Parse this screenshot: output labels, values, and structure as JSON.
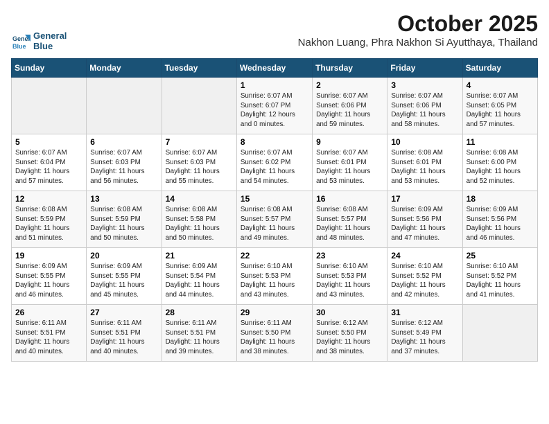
{
  "header": {
    "logo_line1": "General",
    "logo_line2": "Blue",
    "title": "October 2025",
    "subtitle": "Nakhon Luang, Phra Nakhon Si Ayutthaya, Thailand"
  },
  "weekdays": [
    "Sunday",
    "Monday",
    "Tuesday",
    "Wednesday",
    "Thursday",
    "Friday",
    "Saturday"
  ],
  "weeks": [
    [
      {
        "day": "",
        "info": ""
      },
      {
        "day": "",
        "info": ""
      },
      {
        "day": "",
        "info": ""
      },
      {
        "day": "1",
        "info": "Sunrise: 6:07 AM\nSunset: 6:07 PM\nDaylight: 12 hours\nand 0 minutes."
      },
      {
        "day": "2",
        "info": "Sunrise: 6:07 AM\nSunset: 6:06 PM\nDaylight: 11 hours\nand 59 minutes."
      },
      {
        "day": "3",
        "info": "Sunrise: 6:07 AM\nSunset: 6:06 PM\nDaylight: 11 hours\nand 58 minutes."
      },
      {
        "day": "4",
        "info": "Sunrise: 6:07 AM\nSunset: 6:05 PM\nDaylight: 11 hours\nand 57 minutes."
      }
    ],
    [
      {
        "day": "5",
        "info": "Sunrise: 6:07 AM\nSunset: 6:04 PM\nDaylight: 11 hours\nand 57 minutes."
      },
      {
        "day": "6",
        "info": "Sunrise: 6:07 AM\nSunset: 6:03 PM\nDaylight: 11 hours\nand 56 minutes."
      },
      {
        "day": "7",
        "info": "Sunrise: 6:07 AM\nSunset: 6:03 PM\nDaylight: 11 hours\nand 55 minutes."
      },
      {
        "day": "8",
        "info": "Sunrise: 6:07 AM\nSunset: 6:02 PM\nDaylight: 11 hours\nand 54 minutes."
      },
      {
        "day": "9",
        "info": "Sunrise: 6:07 AM\nSunset: 6:01 PM\nDaylight: 11 hours\nand 53 minutes."
      },
      {
        "day": "10",
        "info": "Sunrise: 6:08 AM\nSunset: 6:01 PM\nDaylight: 11 hours\nand 53 minutes."
      },
      {
        "day": "11",
        "info": "Sunrise: 6:08 AM\nSunset: 6:00 PM\nDaylight: 11 hours\nand 52 minutes."
      }
    ],
    [
      {
        "day": "12",
        "info": "Sunrise: 6:08 AM\nSunset: 5:59 PM\nDaylight: 11 hours\nand 51 minutes."
      },
      {
        "day": "13",
        "info": "Sunrise: 6:08 AM\nSunset: 5:59 PM\nDaylight: 11 hours\nand 50 minutes."
      },
      {
        "day": "14",
        "info": "Sunrise: 6:08 AM\nSunset: 5:58 PM\nDaylight: 11 hours\nand 50 minutes."
      },
      {
        "day": "15",
        "info": "Sunrise: 6:08 AM\nSunset: 5:57 PM\nDaylight: 11 hours\nand 49 minutes."
      },
      {
        "day": "16",
        "info": "Sunrise: 6:08 AM\nSunset: 5:57 PM\nDaylight: 11 hours\nand 48 minutes."
      },
      {
        "day": "17",
        "info": "Sunrise: 6:09 AM\nSunset: 5:56 PM\nDaylight: 11 hours\nand 47 minutes."
      },
      {
        "day": "18",
        "info": "Sunrise: 6:09 AM\nSunset: 5:56 PM\nDaylight: 11 hours\nand 46 minutes."
      }
    ],
    [
      {
        "day": "19",
        "info": "Sunrise: 6:09 AM\nSunset: 5:55 PM\nDaylight: 11 hours\nand 46 minutes."
      },
      {
        "day": "20",
        "info": "Sunrise: 6:09 AM\nSunset: 5:55 PM\nDaylight: 11 hours\nand 45 minutes."
      },
      {
        "day": "21",
        "info": "Sunrise: 6:09 AM\nSunset: 5:54 PM\nDaylight: 11 hours\nand 44 minutes."
      },
      {
        "day": "22",
        "info": "Sunrise: 6:10 AM\nSunset: 5:53 PM\nDaylight: 11 hours\nand 43 minutes."
      },
      {
        "day": "23",
        "info": "Sunrise: 6:10 AM\nSunset: 5:53 PM\nDaylight: 11 hours\nand 43 minutes."
      },
      {
        "day": "24",
        "info": "Sunrise: 6:10 AM\nSunset: 5:52 PM\nDaylight: 11 hours\nand 42 minutes."
      },
      {
        "day": "25",
        "info": "Sunrise: 6:10 AM\nSunset: 5:52 PM\nDaylight: 11 hours\nand 41 minutes."
      }
    ],
    [
      {
        "day": "26",
        "info": "Sunrise: 6:11 AM\nSunset: 5:51 PM\nDaylight: 11 hours\nand 40 minutes."
      },
      {
        "day": "27",
        "info": "Sunrise: 6:11 AM\nSunset: 5:51 PM\nDaylight: 11 hours\nand 40 minutes."
      },
      {
        "day": "28",
        "info": "Sunrise: 6:11 AM\nSunset: 5:51 PM\nDaylight: 11 hours\nand 39 minutes."
      },
      {
        "day": "29",
        "info": "Sunrise: 6:11 AM\nSunset: 5:50 PM\nDaylight: 11 hours\nand 38 minutes."
      },
      {
        "day": "30",
        "info": "Sunrise: 6:12 AM\nSunset: 5:50 PM\nDaylight: 11 hours\nand 38 minutes."
      },
      {
        "day": "31",
        "info": "Sunrise: 6:12 AM\nSunset: 5:49 PM\nDaylight: 11 hours\nand 37 minutes."
      },
      {
        "day": "",
        "info": ""
      }
    ]
  ]
}
